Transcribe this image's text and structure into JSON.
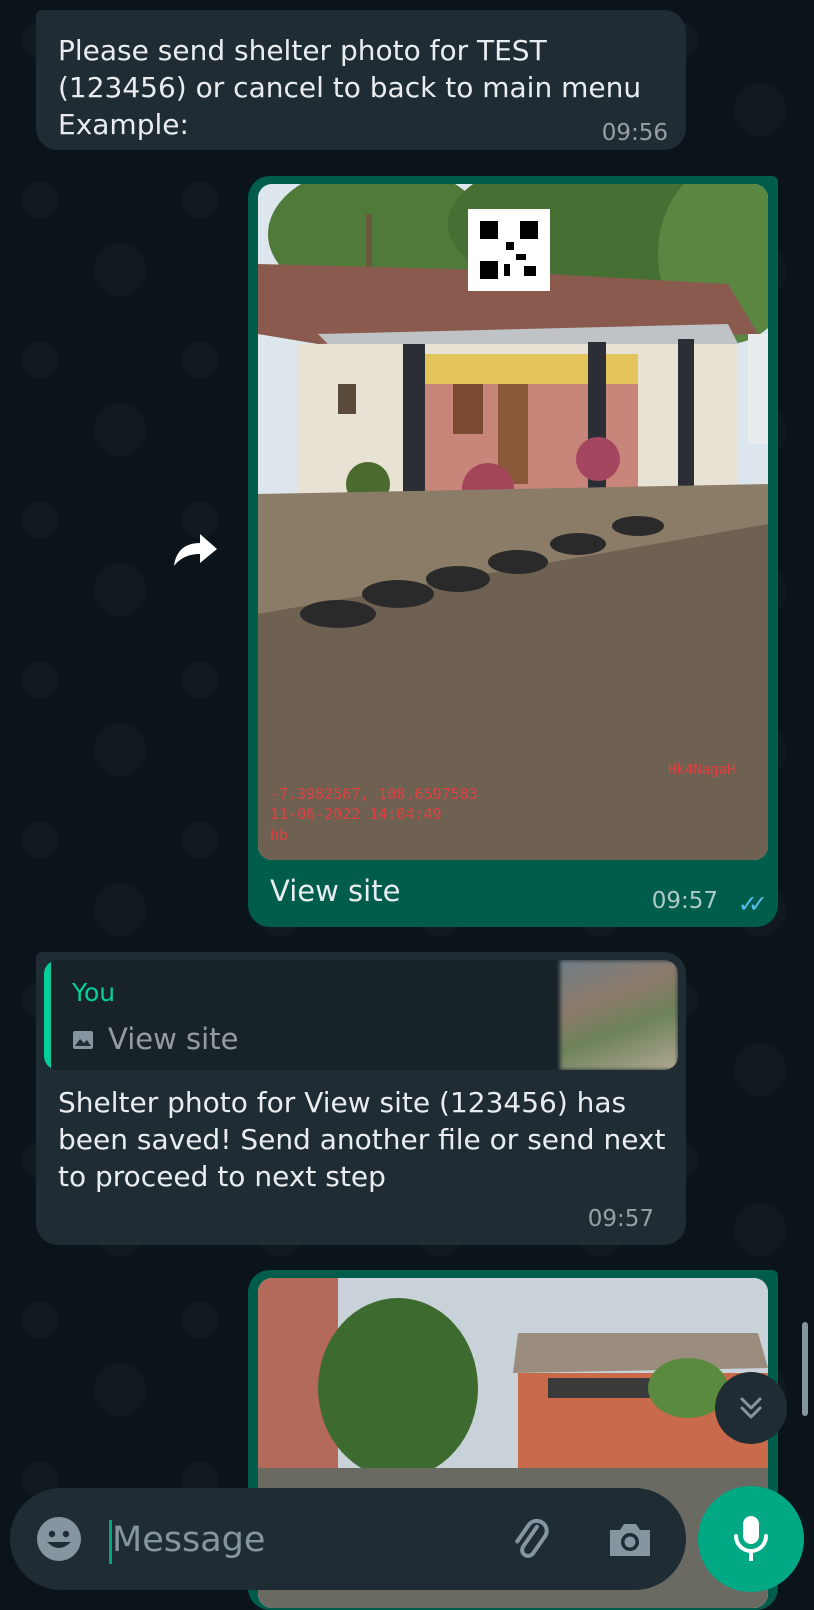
{
  "messages": [
    {
      "text": "Please send shelter photo for TEST (123456) or cancel to back to main menu Example:",
      "time": "09:56"
    },
    {
      "caption": "View site",
      "time": "09:57",
      "ticks": "✓✓",
      "photo_stamp": {
        "coords": "-7.3982567, 108.6597583",
        "datetime": "11-06-2022 14:04:49",
        "initials": "hb",
        "tag": "Hk4NagaH"
      }
    },
    {
      "quote_author": "You",
      "quote_text": "View site",
      "text": "Shelter photo for View site (123456) has been saved! Send another file or send next to proceed to next step",
      "time": "09:57"
    }
  ],
  "input": {
    "placeholder": "Message"
  },
  "colors": {
    "background": "#0b141a",
    "incoming_bubble": "#1f2c34",
    "outgoing_bubble": "#005c4b",
    "accent": "#00a884",
    "quote_accent": "#06cf9c",
    "read_ticks": "#53bdeb"
  },
  "icons": [
    "forward-icon",
    "image-icon",
    "double-check-icon",
    "chevron-double-down-icon",
    "emoji-icon",
    "attach-icon",
    "camera-icon",
    "mic-icon"
  ]
}
